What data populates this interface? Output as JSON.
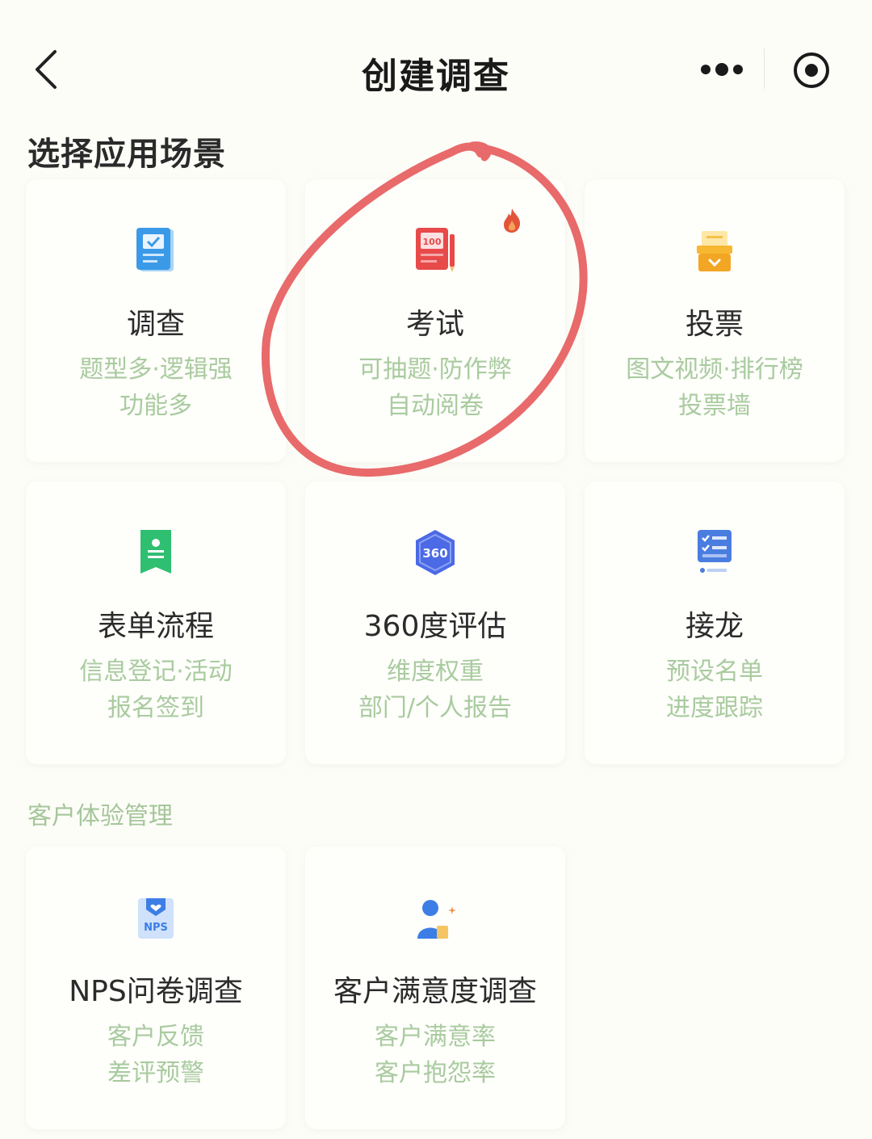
{
  "nav": {
    "title": "创建调查"
  },
  "header": {
    "title": "选择应用场景"
  },
  "scenes": [
    {
      "title": "调查",
      "sub1": "题型多·逻辑强",
      "sub2": "功能多"
    },
    {
      "title": "考试",
      "sub1": "可抽题·防作弊",
      "sub2": "自动阅卷"
    },
    {
      "title": "投票",
      "sub1": "图文视频·排行榜",
      "sub2": "投票墙"
    },
    {
      "title": "表单流程",
      "sub1": "信息登记·活动",
      "sub2": "报名签到"
    },
    {
      "title": "360度评估",
      "sub1": "维度权重",
      "sub2": "部门/个人报告"
    },
    {
      "title": "接龙",
      "sub1": "预设名单",
      "sub2": "进度跟踪"
    }
  ],
  "cx": {
    "label": "客户体验管理",
    "items": [
      {
        "title": "NPS问卷调查",
        "sub1": "客户反馈",
        "sub2": "差评预警"
      },
      {
        "title": "客户满意度调查",
        "sub1": "客户满意率",
        "sub2": "客户抱怨率"
      }
    ]
  },
  "icon_text": {
    "exam_score": "100",
    "eval_360": "360",
    "nps": "NPS"
  },
  "colors": {
    "accent_green": "#a9cb9f",
    "annotation_red": "#e86a6a",
    "hot": "#e2553a"
  }
}
